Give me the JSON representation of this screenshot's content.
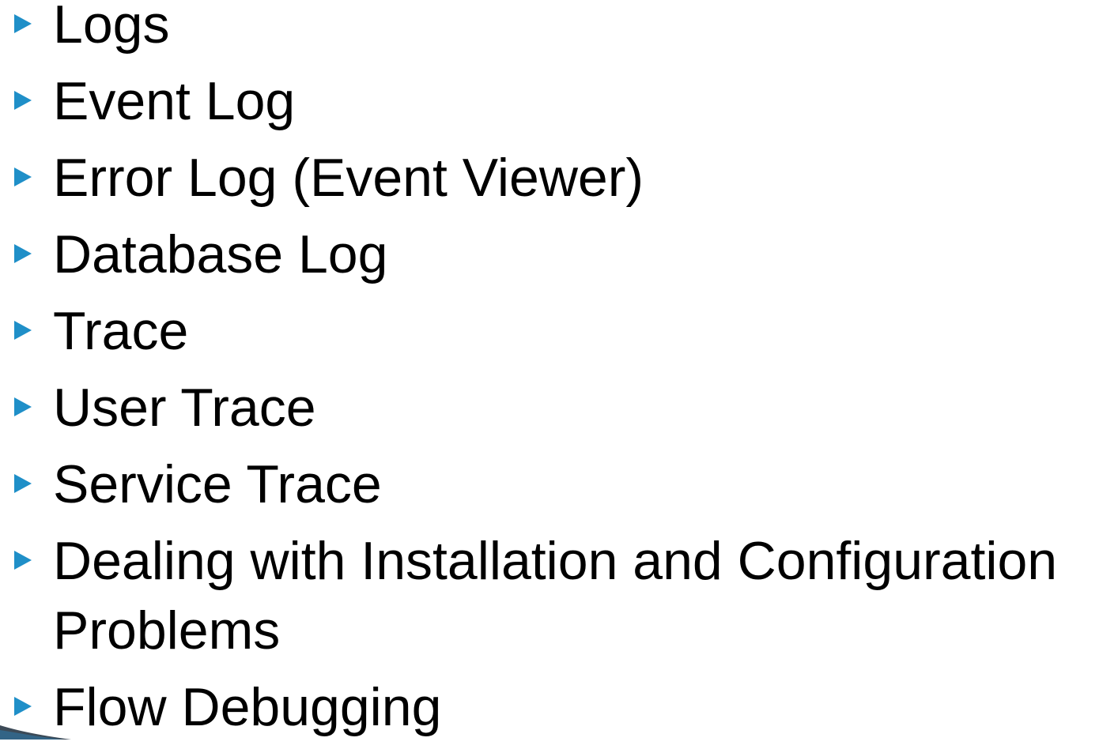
{
  "slide": {
    "bullets": [
      {
        "text": "Logs"
      },
      {
        "text": "Event Log"
      },
      {
        "text": "Error Log (Event Viewer)"
      },
      {
        "text": "Database Log"
      },
      {
        "text": "Trace"
      },
      {
        "text": "User Trace"
      },
      {
        "text": "Service Trace"
      },
      {
        "text": "Dealing with Installation and Configuration Problems"
      },
      {
        "text": "Flow Debugging"
      }
    ]
  },
  "colors": {
    "bullet_marker": "#1F8FC8",
    "text": "#000000",
    "background": "#FFFFFF"
  },
  "icons": {
    "bullet": "triangle-right-icon"
  }
}
